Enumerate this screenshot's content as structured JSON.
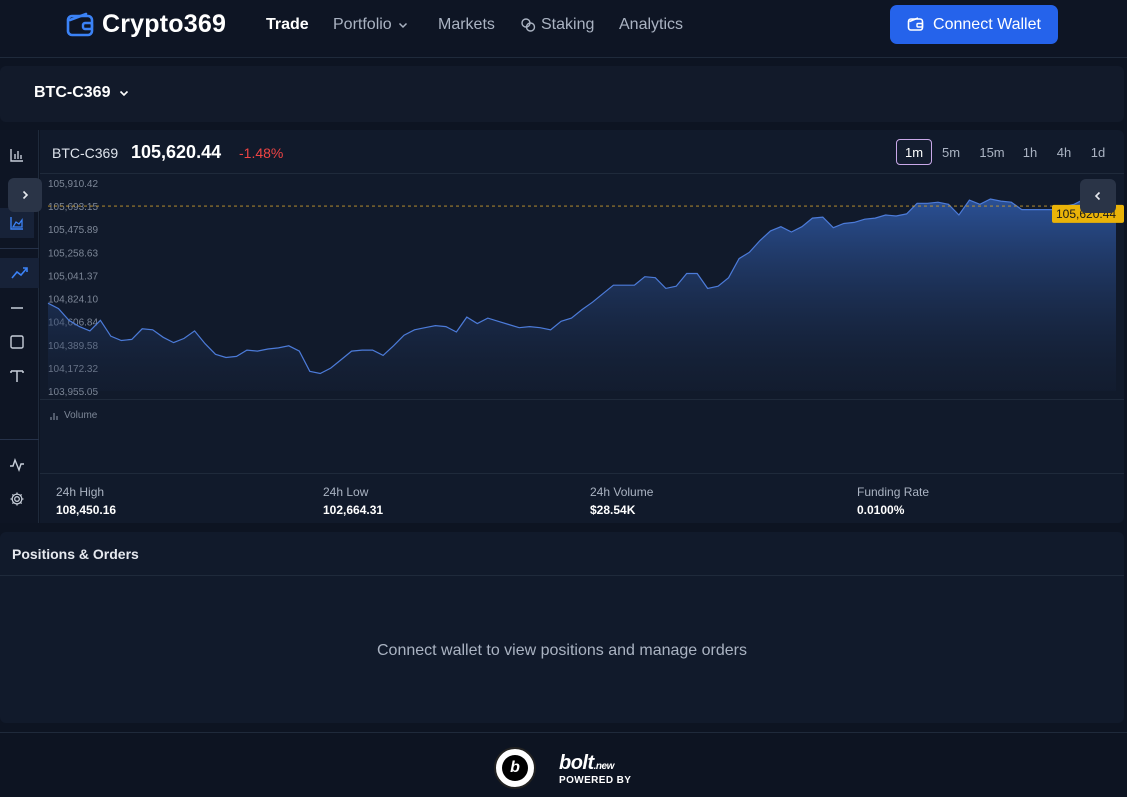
{
  "brand": {
    "name": "Crypto369",
    "accent": "#3b82f6"
  },
  "nav": {
    "trade": "Trade",
    "portfolio": "Portfolio",
    "markets": "Markets",
    "staking": "Staking",
    "analytics": "Analytics"
  },
  "connect_wallet": "Connect Wallet",
  "pair_selector": "BTC-C369",
  "chart_header": {
    "symbol": "BTC-C369",
    "price": "105,620.44",
    "change": "-1.48%",
    "change_color": "#ef4444",
    "timeframes": [
      "1m",
      "5m",
      "15m",
      "1h",
      "4h",
      "1d"
    ],
    "selected_timeframe": "1m"
  },
  "chart_data": {
    "type": "area",
    "y_ticks": [
      "105,910.42",
      "105,693.15",
      "105,475.89",
      "105,258.63",
      "105,041.37",
      "104,824.10",
      "104,606.84",
      "104,389.58",
      "104,172.32",
      "103,955.05"
    ],
    "ylim": [
      103955.05,
      105910.42
    ],
    "current_price_label": "105,620.44",
    "current_price_line": 105693.15,
    "line_color": "#4c7bd9",
    "values": [
      104780,
      104730,
      104620,
      104560,
      104520,
      104620,
      104470,
      104430,
      104440,
      104540,
      104530,
      104460,
      104410,
      104450,
      104520,
      104400,
      104300,
      104270,
      104280,
      104340,
      104330,
      104350,
      104360,
      104380,
      104330,
      104140,
      104120,
      104170,
      104250,
      104330,
      104340,
      104340,
      104290,
      104380,
      104480,
      104530,
      104550,
      104570,
      104560,
      104510,
      104650,
      104590,
      104640,
      104610,
      104580,
      104550,
      104560,
      104550,
      104530,
      104610,
      104640,
      104720,
      104790,
      104870,
      104950,
      104950,
      104950,
      105030,
      105020,
      104920,
      104940,
      105060,
      105060,
      104920,
      104940,
      105020,
      105200,
      105260,
      105370,
      105460,
      105500,
      105450,
      105500,
      105580,
      105590,
      105490,
      105530,
      105540,
      105570,
      105580,
      105610,
      105600,
      105620,
      105720,
      105720,
      105730,
      105710,
      105610,
      105750,
      105710,
      105760,
      105740,
      105730,
      105660,
      105660,
      105660,
      105660,
      105690,
      105710,
      105760,
      105680,
      105700,
      105620
    ]
  },
  "volume_label": "Volume",
  "stats": [
    {
      "label": "24h High",
      "value": "108,450.16"
    },
    {
      "label": "24h Low",
      "value": "102,664.31"
    },
    {
      "label": "24h Volume",
      "value": "$28.54K"
    },
    {
      "label": "Funding Rate",
      "value": "0.0100%"
    }
  ],
  "positions": {
    "title": "Positions & Orders",
    "empty_message": "Connect wallet to view positions and manage orders"
  },
  "footer": {
    "logo_main": "bolt",
    "logo_suffix": ".new",
    "powered_by": "POWERED BY",
    "badge_letter": "b"
  }
}
